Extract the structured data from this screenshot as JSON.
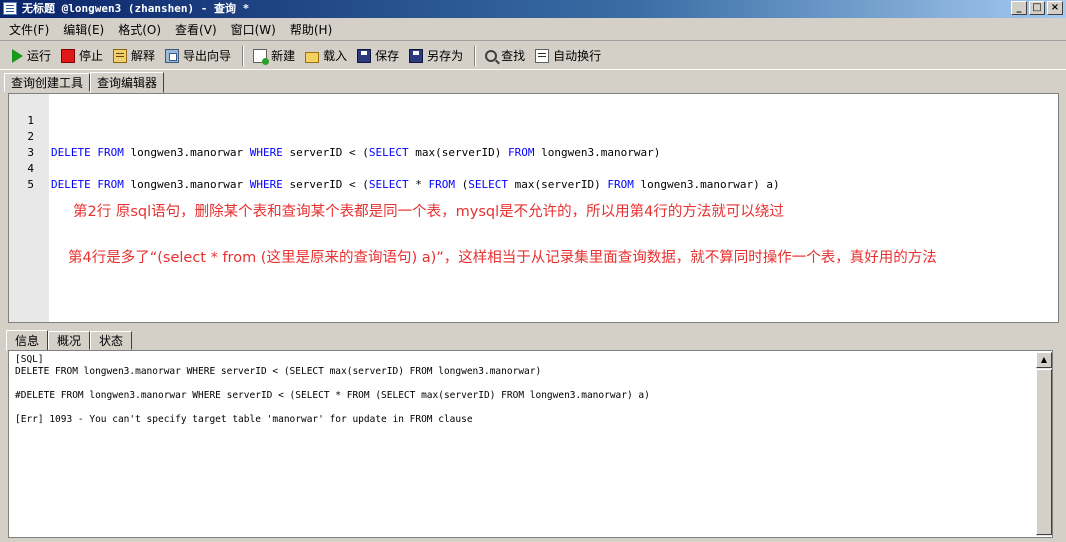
{
  "window": {
    "title": "无标题 @longwen3 (zhanshen) - 查询 *",
    "minimize": "_",
    "maximize": "□",
    "close": "×"
  },
  "menu": [
    "文件(F)",
    "编辑(E)",
    "格式(O)",
    "查看(V)",
    "窗口(W)",
    "帮助(H)"
  ],
  "toolbar": {
    "run": "运行",
    "stop": "停止",
    "explain": "解释",
    "export_wizard": "导出向导",
    "new": "新建",
    "load": "载入",
    "save": "保存",
    "save_as": "另存为",
    "find": "查找",
    "word_wrap": "自动换行"
  },
  "tabs": {
    "builder": "查询创建工具",
    "editor": "查询编辑器"
  },
  "editor": {
    "line_numbers": [
      "1",
      "2",
      "3",
      "4",
      "5"
    ],
    "line2": {
      "k1": "DELETE FROM",
      "t1": " longwen3.manorwar ",
      "k2": "WHERE",
      "t2": " serverID < (",
      "k3": "SELECT",
      "t3": " max(serverID) ",
      "k4": "FROM",
      "t4": " longwen3.manorwar)"
    },
    "line4": {
      "k1": "DELETE FROM",
      "t1": " longwen3.manorwar ",
      "k2": "WHERE",
      "t2": " serverID < (",
      "k3": "SELECT",
      "t3": " * ",
      "k4": "FROM",
      "t4": " (",
      "k5": "SELECT",
      "t5": " max(serverID) ",
      "k6": "FROM",
      "t6": " longwen3.manorwar) a)"
    },
    "note1": "第2行 原sql语句，删除某个表和查询某个表都是同一个表，mysql是不允许的，所以用第4行的方法就可以绕过",
    "note2": "第4行是多了“(select * from (这里是原来的查询语句) a)”，这样相当于从记录集里面查询数据，就不算同时操作一个表，真好用的方法"
  },
  "bottom_tabs": {
    "info": "信息",
    "overview": "概况",
    "status": "状态"
  },
  "messages": {
    "l1": "[SQL]",
    "l2": "DELETE FROM longwen3.manorwar WHERE serverID < (SELECT max(serverID) FROM longwen3.manorwar)",
    "l3": "#DELETE FROM longwen3.manorwar WHERE serverID < (SELECT * FROM (SELECT max(serverID) FROM longwen3.manorwar) a)",
    "l4": "[Err] 1093 - You can't specify target table 'manorwar' for update in FROM clause"
  },
  "colors": {
    "keyword": "#0000ff",
    "note": "#e83030",
    "titlebar": "#0a246a"
  },
  "icons": [
    "app-icon",
    "run-icon",
    "stop-icon",
    "explain-icon",
    "export-icon",
    "new-icon",
    "load-icon",
    "save-icon",
    "save-as-icon",
    "find-icon",
    "word-wrap-icon",
    "scroll-up-icon"
  ]
}
